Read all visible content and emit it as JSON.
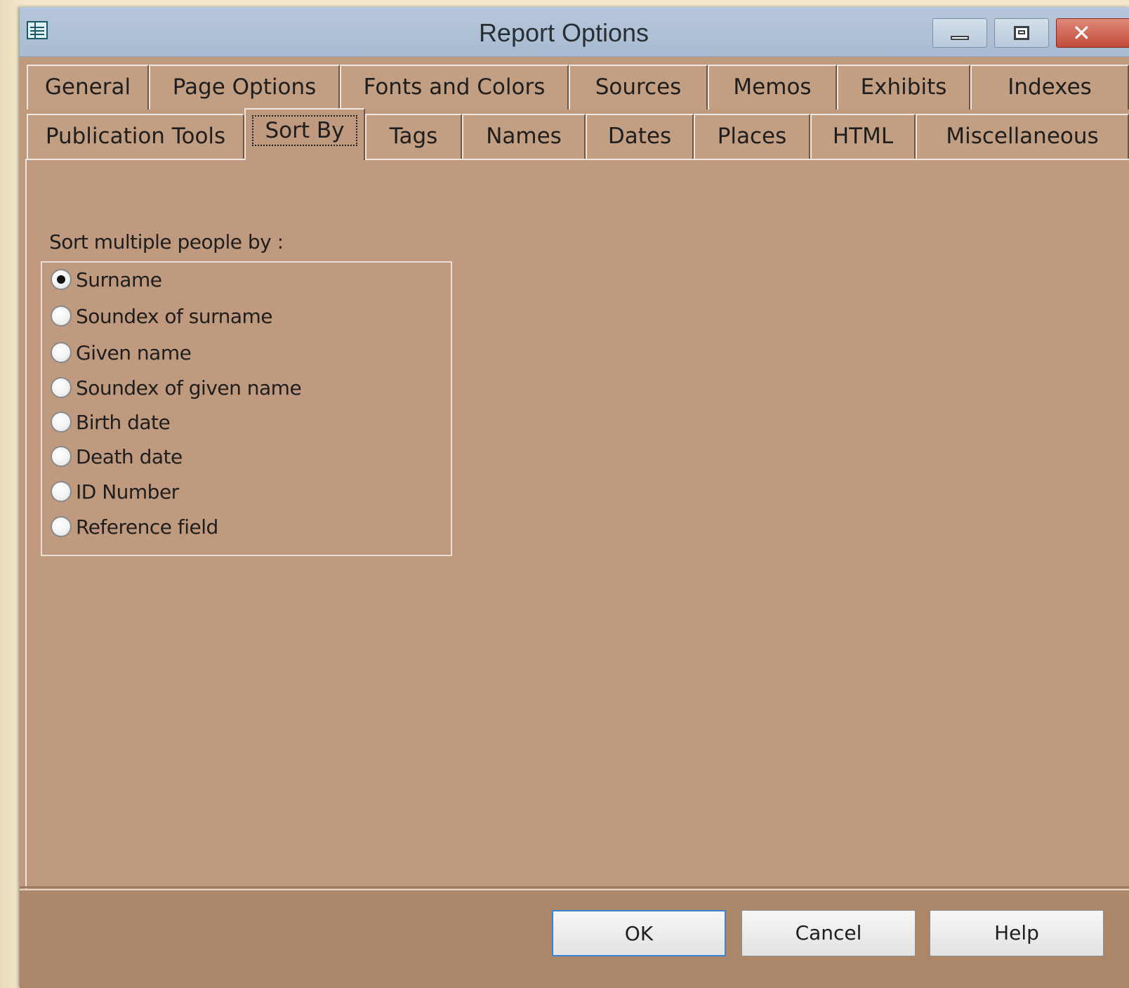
{
  "window": {
    "title": "Report Options",
    "icon": "report-table-icon",
    "controls": {
      "minimize": "minimize-icon",
      "maximize": "maximize-icon",
      "close": "close-icon"
    }
  },
  "tabs": {
    "row1": [
      "General",
      "Page Options",
      "Fonts and Colors",
      "Sources",
      "Memos",
      "Exhibits",
      "Indexes"
    ],
    "row2": [
      "Publication Tools",
      "Sort By",
      "Tags",
      "Names",
      "Dates",
      "Places",
      "HTML",
      "Miscellaneous"
    ],
    "selected": "Sort By"
  },
  "sort": {
    "label": "Sort multiple people by :",
    "options": [
      "Surname",
      "Soundex of surname",
      "Given name",
      "Soundex of given name",
      "Birth date",
      "Death date",
      "ID Number",
      "Reference field"
    ],
    "selected": "Surname"
  },
  "buttons": {
    "ok": "OK",
    "cancel": "Cancel",
    "help": "Help"
  },
  "colors": {
    "dialog_bg": "#bf9a7e",
    "footer_bg": "#ac8669",
    "titlebar": "#b0c1d6",
    "close": "#c94f3d",
    "default_button_border": "#3b82d6"
  }
}
